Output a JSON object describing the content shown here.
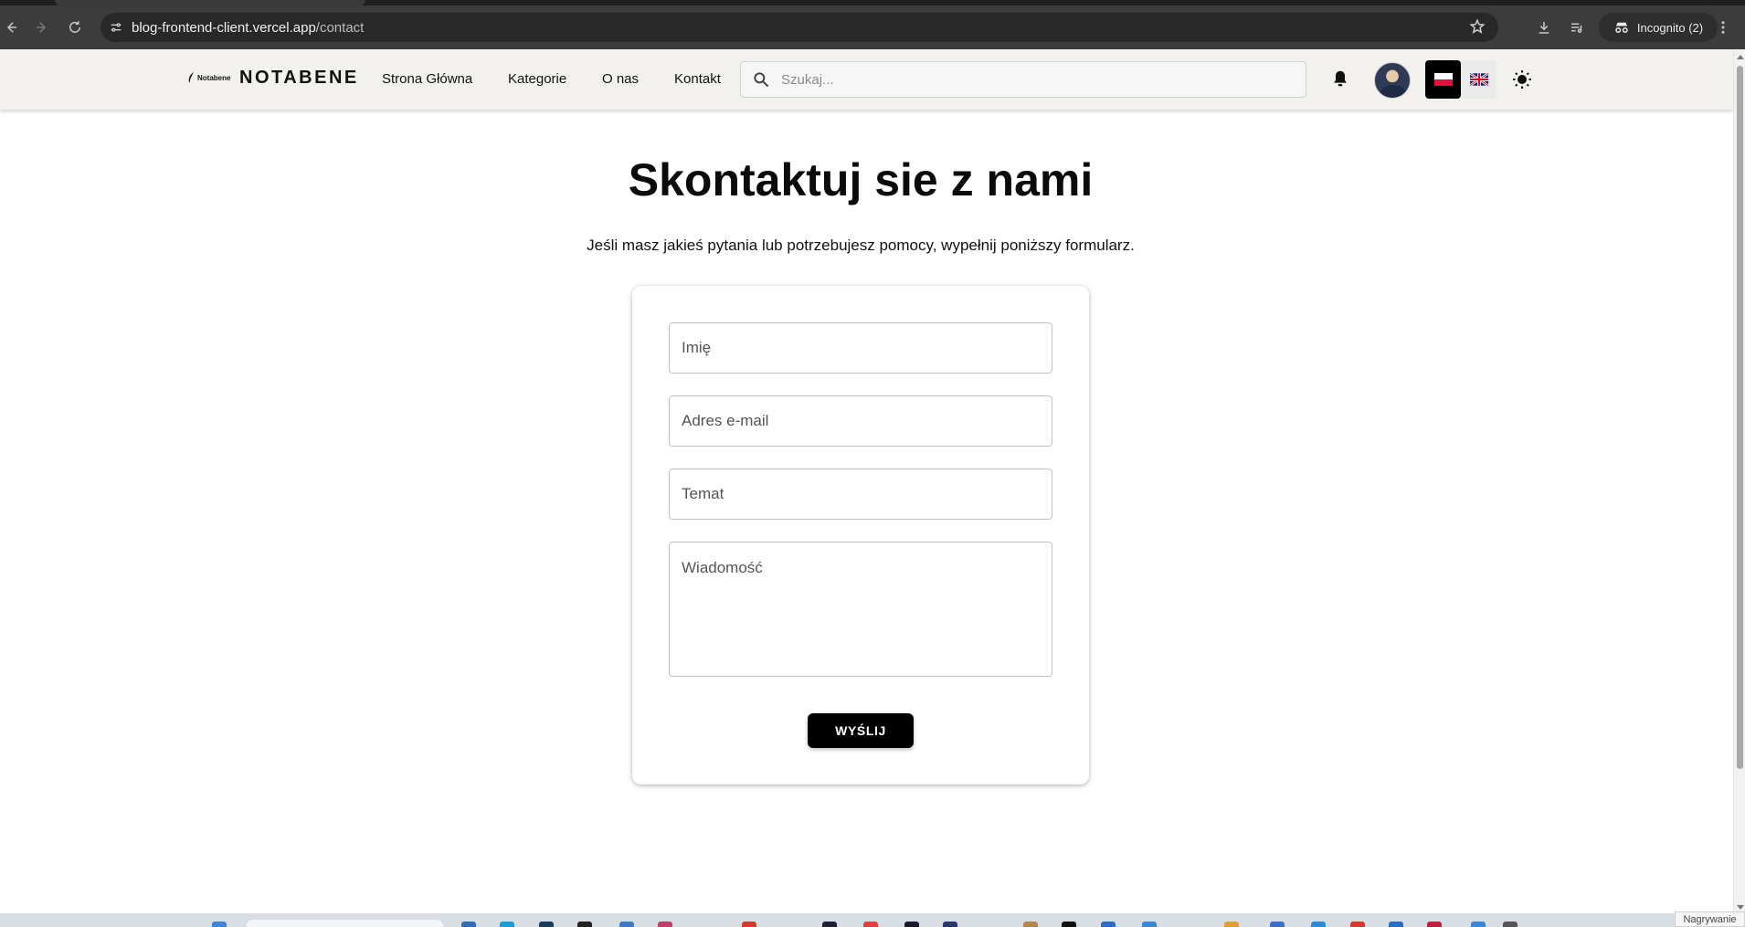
{
  "browser": {
    "url_host": "blog-frontend-client.vercel.app",
    "url_path": "/contact",
    "incognito_label": "Incognito (2)"
  },
  "site": {
    "logo_small_text": "Notabene",
    "logo_text": "NOTABENE",
    "nav": [
      {
        "label": "Strona Główna"
      },
      {
        "label": "Kategorie"
      },
      {
        "label": "O nas"
      },
      {
        "label": "Kontakt"
      }
    ],
    "search_placeholder": "Szukaj..."
  },
  "page": {
    "title": "Skontaktuj sie z nami",
    "subtitle": "Jeśli masz jakieś pytania lub potrzebujesz pomocy, wypełnij poniższy formularz."
  },
  "form": {
    "name_placeholder": "Imię",
    "email_placeholder": "Adres e-mail",
    "subject_placeholder": "Temat",
    "message_placeholder": "Wiadomość",
    "submit_label": "WYŚLIJ"
  },
  "taskbar": {
    "recording_label": "Nagrywanie"
  },
  "icons": {
    "back": "arrow-left-icon",
    "forward": "arrow-right-icon",
    "reload": "reload-icon",
    "site_info": "tune-icon",
    "bookmark": "star-icon",
    "download": "download-icon",
    "media": "playlist-icon",
    "incognito": "incognito-icon",
    "menu": "more-vert-icon",
    "search": "search-icon",
    "notifications": "bell-icon",
    "theme": "sun-icon"
  },
  "colors": {
    "header_bg": "#f2f1ee",
    "button_bg": "#000000",
    "chrome_bg": "#3c3c3c"
  }
}
